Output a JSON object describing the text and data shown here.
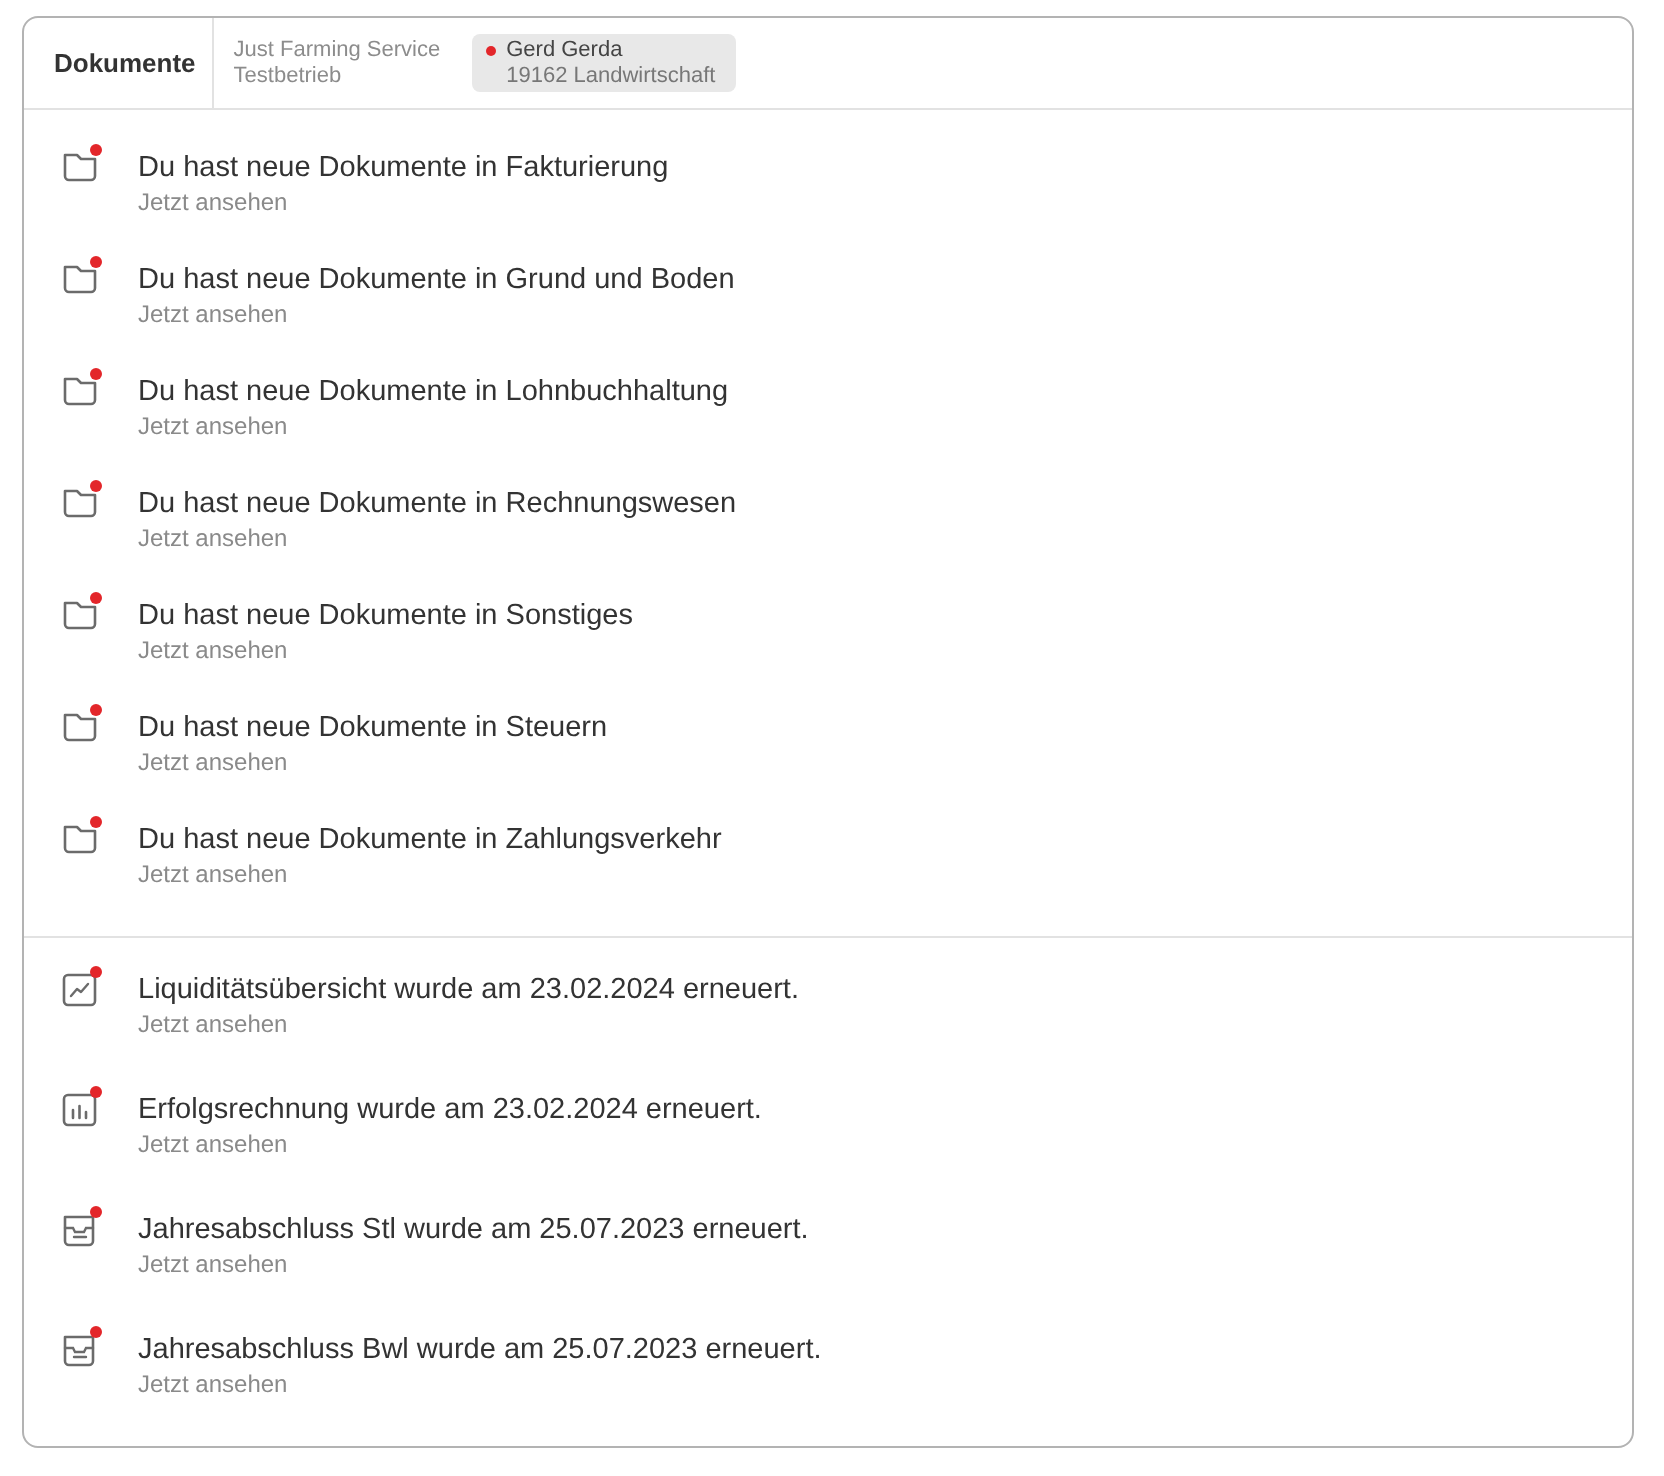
{
  "header": {
    "title": "Dokumente",
    "company": {
      "name": "Just Farming Service",
      "subtitle": "Testbetrieb"
    },
    "client": {
      "notified": true,
      "name": "Gerd Gerda",
      "detail": "19162 Landwirtschaft"
    }
  },
  "sections": [
    {
      "items": [
        {
          "kind": "folder",
          "unread": true,
          "title": "Du hast neue Dokumente in Fakturierung",
          "link": "Jetzt ansehen"
        },
        {
          "kind": "folder",
          "unread": true,
          "title": "Du hast neue Dokumente in Grund und Boden",
          "link": "Jetzt ansehen"
        },
        {
          "kind": "folder",
          "unread": true,
          "title": "Du hast neue Dokumente in Lohnbuchhaltung",
          "link": "Jetzt ansehen"
        },
        {
          "kind": "folder",
          "unread": true,
          "title": "Du hast neue Dokumente in Rechnungswesen",
          "link": "Jetzt ansehen"
        },
        {
          "kind": "folder",
          "unread": true,
          "title": "Du hast neue Dokumente in Sonstiges",
          "link": "Jetzt ansehen"
        },
        {
          "kind": "folder",
          "unread": true,
          "title": "Du hast neue Dokumente in Steuern",
          "link": "Jetzt ansehen"
        },
        {
          "kind": "folder",
          "unread": true,
          "title": "Du hast neue Dokumente in Zahlungsverkehr",
          "link": "Jetzt ansehen"
        }
      ]
    },
    {
      "items": [
        {
          "kind": "line-chart",
          "unread": true,
          "title": "Liquiditätsübersicht wurde am 23.02.2024 erneuert.",
          "link": "Jetzt ansehen"
        },
        {
          "kind": "bar-chart",
          "unread": true,
          "title": "Erfolgsrechnung wurde am 23.02.2024 erneuert.",
          "link": "Jetzt ansehen"
        },
        {
          "kind": "report",
          "unread": true,
          "title": "Jahresabschluss Stl wurde am 25.07.2023 erneuert.",
          "link": "Jetzt ansehen"
        },
        {
          "kind": "report",
          "unread": true,
          "title": "Jahresabschluss Bwl wurde am 25.07.2023 erneuert.",
          "link": "Jetzt ansehen"
        }
      ]
    }
  ]
}
